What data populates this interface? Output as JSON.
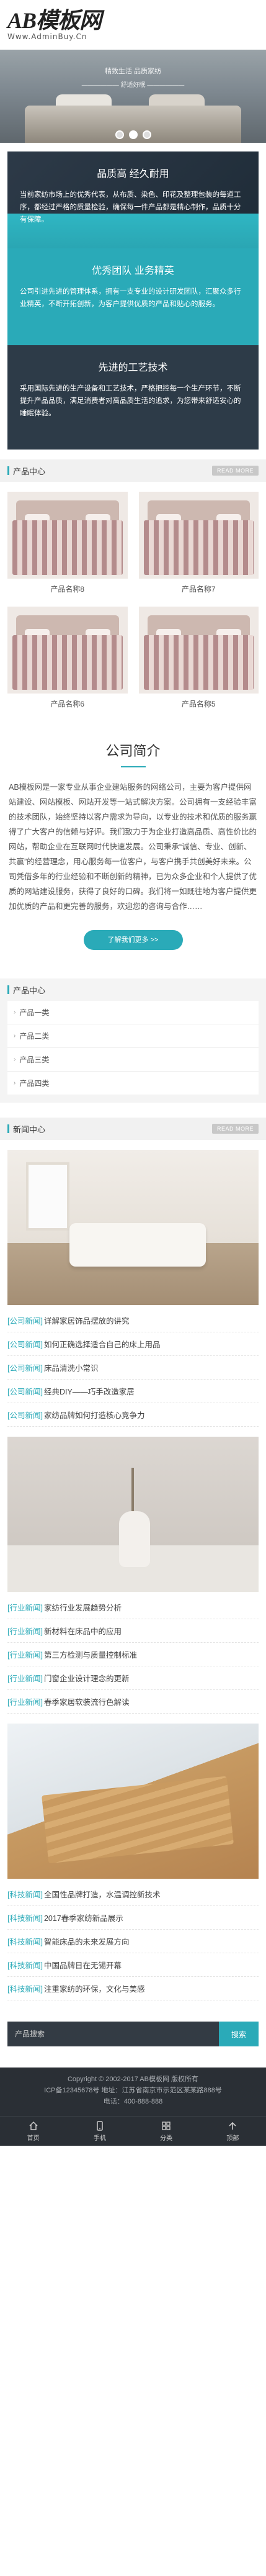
{
  "header": {
    "logo_text": "AB模板网",
    "logo_sub": "Www.AdminBuy.Cn"
  },
  "banner": {
    "line1": "精致生活 品质家纺",
    "line2": "—————— 舒适好眠 ——————",
    "slides": 3,
    "active_slide": 2
  },
  "features": [
    {
      "title": "品质高 经久耐用",
      "text": "当前家纺市场上的优秀代表，从布质、染色、印花及整理包装的每道工序，都经过严格的质量检验，确保每一件产品都是精心制作，品质十分有保障。"
    },
    {
      "title": "优秀团队 业务精英",
      "text": "公司引进先进的管理体系，拥有一支专业的设计研发团队，汇聚众多行业精英，不断开拓创新，为客户提供优质的产品和贴心的服务。"
    },
    {
      "title": "先进的工艺技术",
      "text": "采用国际先进的生产设备和工艺技术，严格把控每一个生产环节，不断提升产品品质，满足消费者对高品质生活的追求，为您带来舒适安心的睡眠体验。"
    }
  ],
  "products_section": {
    "title": "产品中心",
    "more": "READ MORE"
  },
  "products": [
    {
      "name": "产品名称8"
    },
    {
      "name": "产品名称7"
    },
    {
      "name": "产品名称6"
    },
    {
      "name": "产品名称5"
    }
  ],
  "company": {
    "title": "公司简介",
    "text": "AB模板网是一家专业从事企业建站服务的网络公司，主要为客户提供网站建设、网站模板、网站开发等一站式解决方案。公司拥有一支经验丰富的技术团队，始终坚持以客户需求为导向，以专业的技术和优质的服务赢得了广大客户的信赖与好评。我们致力于为企业打造高品质、高性价比的网站，帮助企业在互联网时代快速发展。公司秉承“诚信、专业、创新、共赢”的经营理念，用心服务每一位客户，与客户携手共创美好未来。公司凭借多年的行业经验和不断创新的精神，已为众多企业和个人提供了优质的网站建设服务，获得了良好的口碑。我们将一如既往地为客户提供更加优质的产品和更完善的服务，欢迎您的咨询与合作……",
    "button": "了解我们更多 >>"
  },
  "categories": {
    "title": "产品中心",
    "items": [
      "产品一类",
      "产品二类",
      "产品三类",
      "产品四类"
    ]
  },
  "news_section": {
    "title": "新闻中心",
    "more": "READ MORE"
  },
  "news_groups": [
    {
      "items": [
        {
          "tag": "[公司新闻]",
          "title": "详解家居饰品摆放的讲究"
        },
        {
          "tag": "[公司新闻]",
          "title": "如何正确选择适合自己的床上用品"
        },
        {
          "tag": "[公司新闻]",
          "title": "床品清洗小常识"
        },
        {
          "tag": "[公司新闻]",
          "title": "经典DIY——巧手改造家居"
        },
        {
          "tag": "[公司新闻]",
          "title": "家纺品牌如何打造核心竞争力"
        }
      ]
    },
    {
      "items": [
        {
          "tag": "[行业新闻]",
          "title": "家纺行业发展趋势分析"
        },
        {
          "tag": "[行业新闻]",
          "title": "新材料在床品中的应用"
        },
        {
          "tag": "[行业新闻]",
          "title": "第三方检测与质量控制标准"
        },
        {
          "tag": "[行业新闻]",
          "title": "门窗企业设计理念的更新"
        },
        {
          "tag": "[行业新闻]",
          "title": "春季家居软装流行色解读"
        }
      ]
    },
    {
      "items": [
        {
          "tag": "[科技新闻]",
          "title": "全国性品牌打造，水温调控新技术"
        },
        {
          "tag": "[科技新闻]",
          "title": "2017春季家纺新品展示"
        },
        {
          "tag": "[科技新闻]",
          "title": "智能床品的未来发展方向"
        },
        {
          "tag": "[科技新闻]",
          "title": "中国品牌日在无锡开幕"
        },
        {
          "tag": "[科技新闻]",
          "title": "注重家纺的环保，文化与美感"
        }
      ]
    }
  ],
  "search": {
    "placeholder": "产品搜索",
    "button": "搜索"
  },
  "footer": {
    "line1": "Copyright © 2002-2017 AB模板网 版权所有",
    "line2": "ICP备12345678号 地址：江苏省南京市示范区某某路888号",
    "line3": "电话：400-888-888"
  },
  "bottom_nav": [
    {
      "label": "首页",
      "icon": "home-icon"
    },
    {
      "label": "手机",
      "icon": "phone-icon"
    },
    {
      "label": "分类",
      "icon": "grid-icon"
    },
    {
      "label": "顶部",
      "icon": "arrow-up-icon"
    }
  ],
  "colors": {
    "accent": "#2aaab8",
    "dark": "#2d3b48",
    "footer": "#2a2f35"
  }
}
